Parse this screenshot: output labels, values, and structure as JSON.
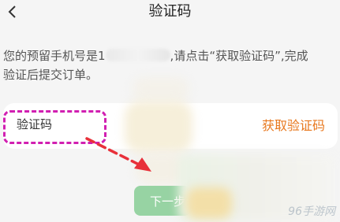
{
  "header": {
    "title": "验证码",
    "back_icon": "chevron-left-icon"
  },
  "notice": {
    "line1_prefix": "您的预留手机号是1",
    "line1_suffix": ",请点击“获取验证码”,完成",
    "line2": "验证后提交订单。"
  },
  "code_form": {
    "placeholder": "验证码",
    "get_code_label": "获取验证码"
  },
  "next_label": "下一步",
  "watermark": "96手游网",
  "colors": {
    "accent": "#e8781e",
    "highlight": "#d11fb1",
    "arrow": "#e8303a",
    "next_button": "#97d3a3"
  }
}
